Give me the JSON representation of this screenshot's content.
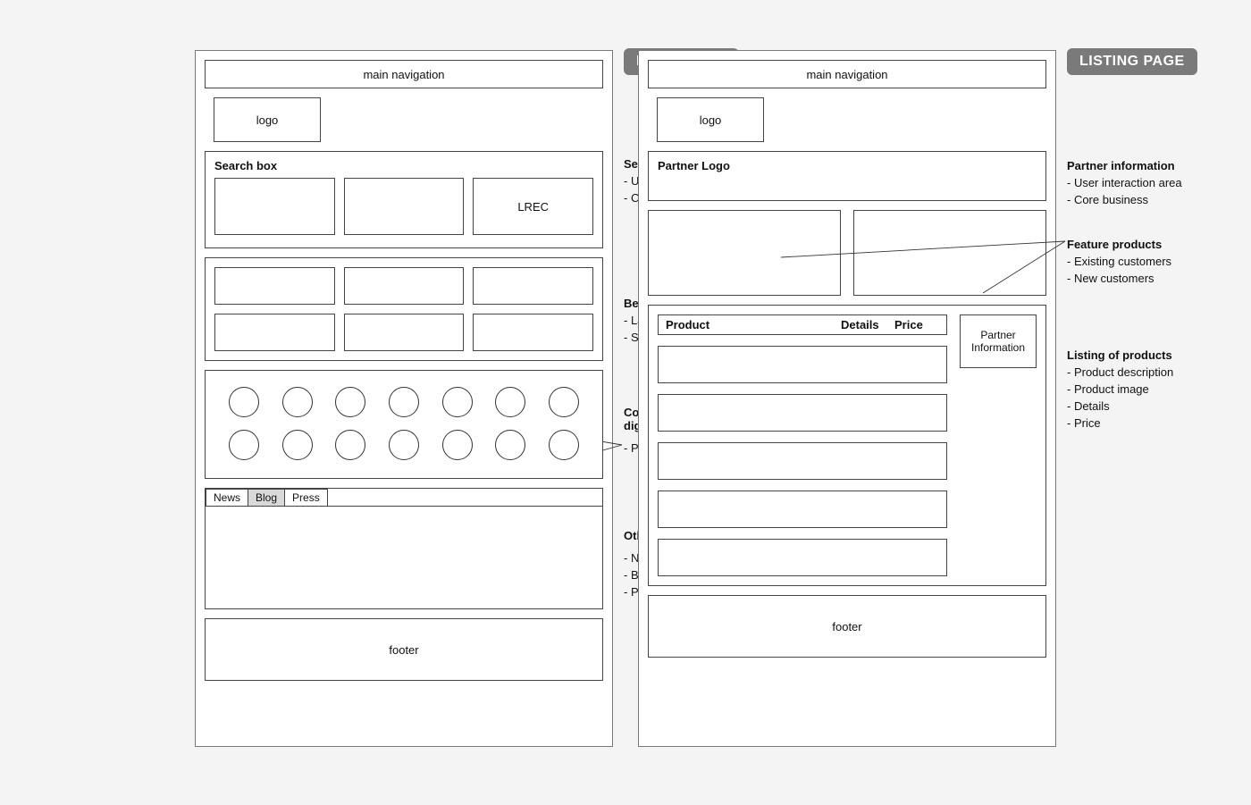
{
  "home": {
    "badge": "HOME PAGE",
    "nav_label": "main navigation",
    "logo_label": "logo",
    "search_label": "Search box",
    "lrec_label": "LREC",
    "tabs": {
      "news": "News",
      "blog": "Blog",
      "press": "Press"
    },
    "footer_label": "footer",
    "annotations": {
      "search": {
        "title": "Search area",
        "b1": "- User interaction area",
        "b2": "- Core business"
      },
      "deals": {
        "title": "Best-selling deals",
        "b1": "- Latest offer",
        "b2": "- Special packages"
      },
      "compare": {
        "title": "Compare broadband and digital TV providers",
        "sub": "- Partners logos"
      },
      "other": {
        "title": "Other information",
        "b1": "- News",
        "b2": "- Blog",
        "b3": "- Press"
      }
    }
  },
  "listing": {
    "badge": "LISTING PAGE",
    "nav_label": "main navigation",
    "logo_label": "logo",
    "partner_logo_label": "Partner Logo",
    "table": {
      "col_product": "Product",
      "col_details": "Details",
      "col_price": "Price"
    },
    "partner_info_label": "Partner Information",
    "footer_label": "footer",
    "annotations": {
      "partner": {
        "title": "Partner information",
        "b1": "- User interaction area",
        "b2": "- Core business"
      },
      "features": {
        "title": "Feature products",
        "b1": "- Existing customers",
        "b2": "- New customers"
      },
      "listing": {
        "title": "Listing of products",
        "b1": "- Product description",
        "b2": "- Product image",
        "b3": "- Details",
        "b4": "- Price"
      }
    }
  }
}
